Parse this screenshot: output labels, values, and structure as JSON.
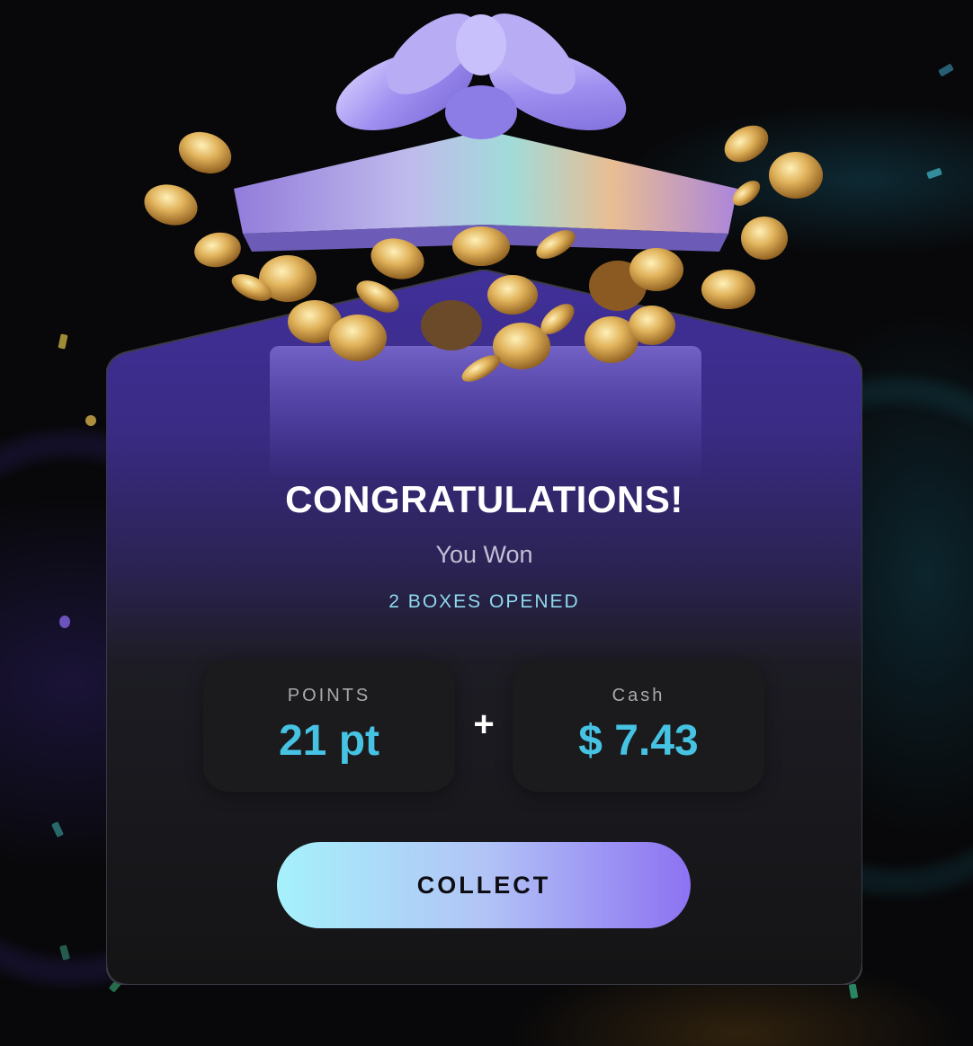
{
  "modal": {
    "title": "CONGRATULATIONS!",
    "subtitle": "You Won",
    "boxes_opened": "2 BOXES OPENED",
    "operator": "+",
    "points": {
      "label": "POINTS",
      "value": "21 pt"
    },
    "cash": {
      "label": "Cash",
      "value": "$ 7.43"
    },
    "collect_label": "COLLECT"
  },
  "illustration": {
    "name": "gift-box-with-coins",
    "colors": {
      "box": "#b7a4ef",
      "ribbon": "#9f8ff0",
      "coin": "#d8a64a"
    }
  },
  "colors": {
    "accent": "#46c2e2",
    "card_top": "#3e2f8f",
    "card_bottom": "#161617",
    "button_start": "#a5f1fb",
    "button_end": "#8d72f2"
  }
}
